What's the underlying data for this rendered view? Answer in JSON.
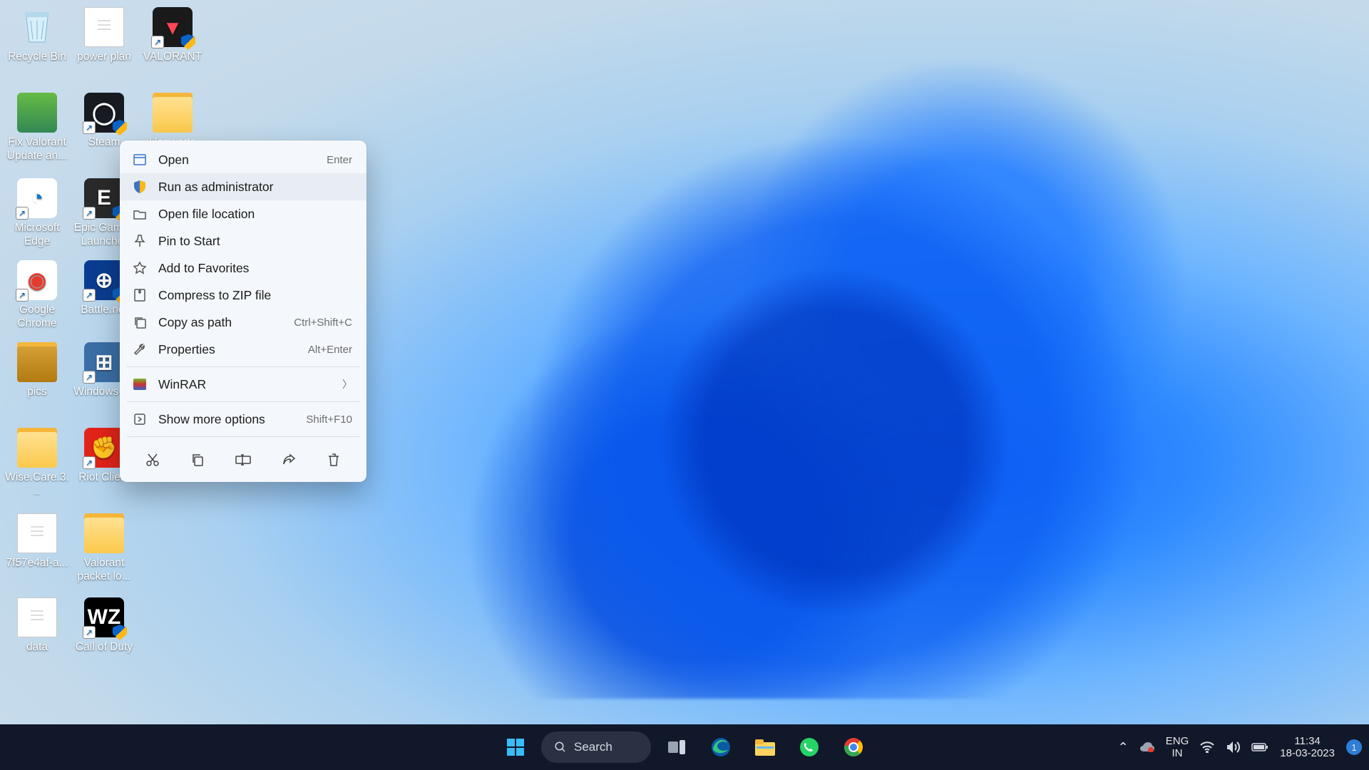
{
  "desktop_icons": [
    {
      "id": "recycle-bin",
      "label": "Recycle Bin",
      "kind": "bin",
      "col": 0,
      "row": 0
    },
    {
      "id": "power-plan",
      "label": "power plan",
      "kind": "doc",
      "col": 1,
      "row": 0
    },
    {
      "id": "valorant",
      "label": "VALORANT",
      "kind": "app",
      "col": 2,
      "row": 0,
      "shortcut": true,
      "shield": true,
      "bg": "#1a1a1a",
      "glyph": "▾",
      "glyphColor": "#ff4655"
    },
    {
      "id": "fix-valorant",
      "label": "Fix Valorant Update an...",
      "kind": "img",
      "col": 0,
      "row": 1
    },
    {
      "id": "steam",
      "label": "Steam",
      "kind": "app",
      "col": 1,
      "row": 1,
      "shortcut": true,
      "shield": true,
      "bg": "#171a21",
      "glyph": "◯"
    },
    {
      "id": "hogwarts",
      "label": "Hogwarts",
      "kind": "folder",
      "col": 2,
      "row": 1
    },
    {
      "id": "edge",
      "label": "Microsoft Edge",
      "kind": "app",
      "col": 0,
      "row": 2,
      "shortcut": true,
      "bg": "#fff",
      "glyph": "◔",
      "glyphColor": "#0b78d0"
    },
    {
      "id": "epic",
      "label": "Epic Games Launcher",
      "kind": "app",
      "col": 1,
      "row": 2,
      "shortcut": true,
      "shield": true,
      "bg": "#2a2a2a",
      "glyph": "E"
    },
    {
      "id": "chrome",
      "label": "Google Chrome",
      "kind": "app",
      "col": 0,
      "row": 3,
      "shortcut": true,
      "bg": "#fff",
      "glyph": "◉",
      "glyphColor": "#e33b2e"
    },
    {
      "id": "battlenet",
      "label": "Battle.net",
      "kind": "app",
      "col": 1,
      "row": 3,
      "shortcut": true,
      "shield": true,
      "bg": "#0a3d91",
      "glyph": "⊕"
    },
    {
      "id": "pics",
      "label": "pics",
      "kind": "folder",
      "col": 0,
      "row": 4,
      "variant": "dark"
    },
    {
      "id": "windows-iso",
      "label": "Windows-I...",
      "kind": "app",
      "col": 1,
      "row": 4,
      "shortcut": true,
      "bg": "#3a6ea5",
      "glyph": "⊞"
    },
    {
      "id": "wisecare",
      "label": "Wise.Care.3...",
      "kind": "folder",
      "col": 0,
      "row": 5
    },
    {
      "id": "riot-client",
      "label": "Riot Client",
      "kind": "app",
      "col": 1,
      "row": 5,
      "shortcut": true,
      "bg": "#e2231a",
      "glyph": "✊"
    },
    {
      "id": "hash-file",
      "label": "7f57e4af-a...",
      "kind": "doc",
      "col": 0,
      "row": 6
    },
    {
      "id": "valorant-packet",
      "label": "Valorant packet lo...",
      "kind": "folder",
      "col": 1,
      "row": 6
    },
    {
      "id": "data",
      "label": "data",
      "kind": "doc",
      "col": 0,
      "row": 7
    },
    {
      "id": "cod",
      "label": "Call of Duty",
      "kind": "app",
      "col": 1,
      "row": 7,
      "shortcut": true,
      "shield": true,
      "bg": "#000",
      "glyph": "WZ",
      "glyphColor": "#fff"
    }
  ],
  "context_menu": {
    "items": [
      {
        "id": "open",
        "label": "Open",
        "accel": "Enter",
        "icon": "window"
      },
      {
        "id": "run-admin",
        "label": "Run as administrator",
        "icon": "shield",
        "hover": true
      },
      {
        "id": "open-loc",
        "label": "Open file location",
        "icon": "folder"
      },
      {
        "id": "pin-start",
        "label": "Pin to Start",
        "icon": "pin"
      },
      {
        "id": "favorites",
        "label": "Add to Favorites",
        "icon": "star"
      },
      {
        "id": "zip",
        "label": "Compress to ZIP file",
        "icon": "zip"
      },
      {
        "id": "copy-path",
        "label": "Copy as path",
        "accel": "Ctrl+Shift+C",
        "icon": "copypath"
      },
      {
        "id": "properties",
        "label": "Properties",
        "accel": "Alt+Enter",
        "icon": "wrench"
      },
      {
        "sep": true
      },
      {
        "id": "winrar",
        "label": "WinRAR",
        "icon": "winrar",
        "submenu": true
      },
      {
        "sep": true
      },
      {
        "id": "more",
        "label": "Show more options",
        "accel": "Shift+F10",
        "icon": "more"
      }
    ],
    "action_row": [
      {
        "id": "cut",
        "name": "cut-icon"
      },
      {
        "id": "copy",
        "name": "copy-icon"
      },
      {
        "id": "rename",
        "name": "rename-icon"
      },
      {
        "id": "share",
        "name": "share-icon"
      },
      {
        "id": "delete",
        "name": "delete-icon"
      }
    ]
  },
  "taskbar": {
    "search_label": "Search",
    "pinned": [
      {
        "id": "start",
        "name": "start-button"
      },
      {
        "id": "search",
        "name": "search-box"
      },
      {
        "id": "taskview",
        "name": "task-view-button"
      },
      {
        "id": "edge",
        "name": "edge-taskbar-icon"
      },
      {
        "id": "explorer",
        "name": "file-explorer-taskbar-icon"
      },
      {
        "id": "whatsapp",
        "name": "whatsapp-taskbar-icon"
      },
      {
        "id": "chrome",
        "name": "chrome-taskbar-icon"
      }
    ],
    "tray": {
      "lang_top": "ENG",
      "lang_bottom": "IN",
      "time": "11:34",
      "date": "18-03-2023",
      "notif_count": "1"
    }
  }
}
